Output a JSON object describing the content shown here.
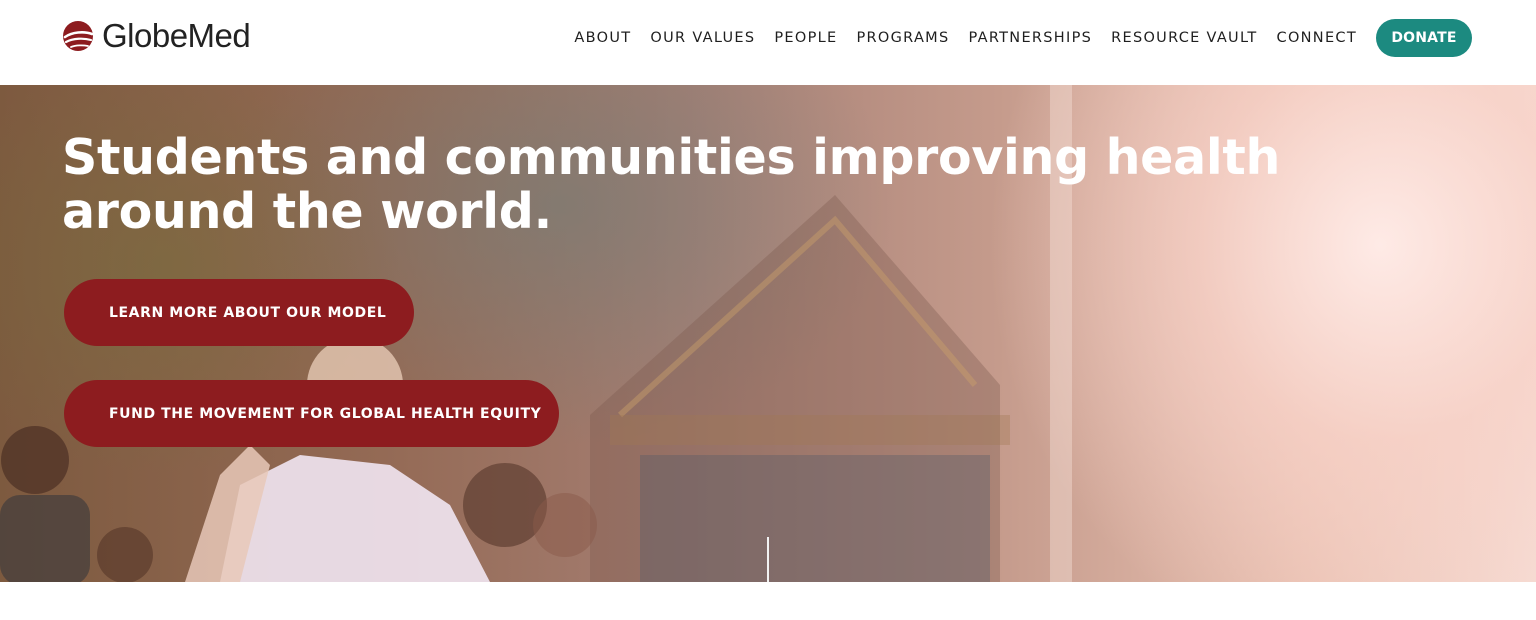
{
  "header": {
    "logo": {
      "text": "GlobeMed",
      "icon": "globe-logo-icon",
      "color": "#8d1c1f"
    },
    "nav": [
      {
        "label": "ABOUT"
      },
      {
        "label": "OUR VALUES"
      },
      {
        "label": "PEOPLE"
      },
      {
        "label": "PROGRAMS"
      },
      {
        "label": "PARTNERSHIPS"
      },
      {
        "label": "RESOURCE VAULT"
      },
      {
        "label": "CONNECT"
      }
    ],
    "donate": {
      "label": "DONATE",
      "color": "#1c8a80"
    }
  },
  "hero": {
    "title": "Students and communities improving health around the world.",
    "buttons": [
      {
        "label": "LEARN MORE ABOUT OUR MODEL"
      },
      {
        "label": "FUND THE MOVEMENT FOR GLOBAL HEALTH EQUITY"
      }
    ],
    "button_color": "#8d1c1f"
  }
}
